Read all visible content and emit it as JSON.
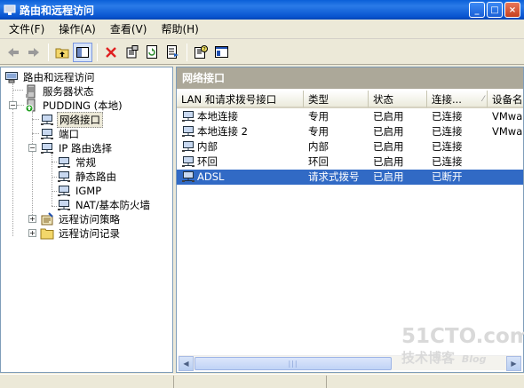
{
  "window": {
    "title": "路由和远程访问",
    "controls": [
      "_",
      "□",
      "×"
    ]
  },
  "menubar": {
    "items": [
      "文件(F)",
      "操作(A)",
      "查看(V)",
      "帮助(H)"
    ]
  },
  "toolbar": {
    "buttons": [
      "back-arrow-icon",
      "forward-arrow-icon",
      "up-folder-icon",
      "show-hide-tree-icon",
      "delete-icon",
      "properties-icon",
      "refresh-icon",
      "export-list-icon",
      "help-icon",
      "console-icon"
    ]
  },
  "tree": {
    "items": [
      {
        "label": "路由和远程访问",
        "icon": "routing-icon"
      },
      {
        "label": "服务器状态",
        "icon": "server-icon"
      },
      {
        "label": "PUDDING (本地)",
        "icon": "server-up-icon"
      },
      {
        "label": "网络接口",
        "icon": "network-icon"
      },
      {
        "label": "端口",
        "icon": "network-icon"
      },
      {
        "label": "IP 路由选择",
        "icon": "network-icon"
      },
      {
        "label": "常规",
        "icon": "network-icon"
      },
      {
        "label": "静态路由",
        "icon": "network-icon"
      },
      {
        "label": "IGMP",
        "icon": "network-icon"
      },
      {
        "label": "NAT/基本防火墙",
        "icon": "network-icon"
      },
      {
        "label": "远程访问策略",
        "icon": "policy-icon"
      },
      {
        "label": "远程访问记录",
        "icon": "folder-icon"
      }
    ]
  },
  "pane": {
    "title": "网络接口",
    "columns": [
      "LAN 和请求拨号接口",
      "类型",
      "状态",
      "连接...",
      "设备名"
    ],
    "rows": [
      [
        "本地连接",
        "专用",
        "已启用",
        "已连接",
        "VMwa"
      ],
      [
        "本地连接 2",
        "专用",
        "已启用",
        "已连接",
        "VMwa"
      ],
      [
        "内部",
        "内部",
        "已启用",
        "已连接",
        ""
      ],
      [
        "环回",
        "环回",
        "已启用",
        "已连接",
        ""
      ],
      [
        "ADSL",
        "请求式拨号",
        "已启用",
        "已断开",
        ""
      ]
    ],
    "selected_row": 4
  },
  "watermark": {
    "main": "51CTO.com",
    "sub": "技术博客",
    "blog": "Blog"
  },
  "colors": {
    "titlebar": "#0a5fd8",
    "selection": "#316ac5",
    "pane_header": "#aca899"
  }
}
